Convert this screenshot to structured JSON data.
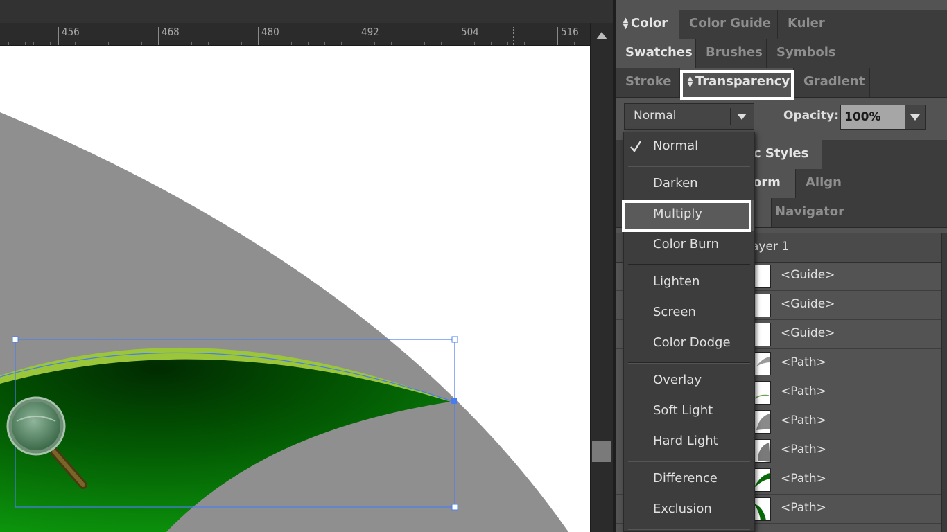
{
  "ruler": {
    "labels": [
      "456",
      "468",
      "480",
      "492",
      "504",
      "516"
    ]
  },
  "panels": {
    "row1": [
      "Color",
      "Color Guide",
      "Kuler"
    ],
    "row2": [
      "Swatches",
      "Brushes",
      "Symbols"
    ],
    "row3": [
      "Stroke",
      "Transparency",
      "Gradient"
    ],
    "row_graphic_styles": "hic Styles",
    "row_transform": [
      "form",
      "Align"
    ],
    "row_navigator": "Navigator"
  },
  "transparency": {
    "blend_mode": "Normal",
    "opacity_label": "Opacity:",
    "opacity_value": "100%"
  },
  "blend_menu": {
    "items": [
      "Normal",
      "Darken",
      "Multiply",
      "Color Burn",
      "Lighten",
      "Screen",
      "Color Dodge",
      "Overlay",
      "Soft Light",
      "Hard Light",
      "Difference",
      "Exclusion"
    ],
    "checked": "Normal",
    "highlighted": "Multiply"
  },
  "layers": {
    "layer_name": "ayer 1",
    "rows": [
      "<Guide>",
      "<Guide>",
      "<Guide>",
      "<Path>",
      "<Path>",
      "<Path>",
      "<Path>",
      "<Path>",
      "<Path>"
    ]
  },
  "colors": {
    "accent_selection": "#4a7cf0",
    "leaf_green": "#0a7a0a",
    "leaf_rim": "#9bc63a",
    "gray_shape": "#8f8f8f"
  }
}
